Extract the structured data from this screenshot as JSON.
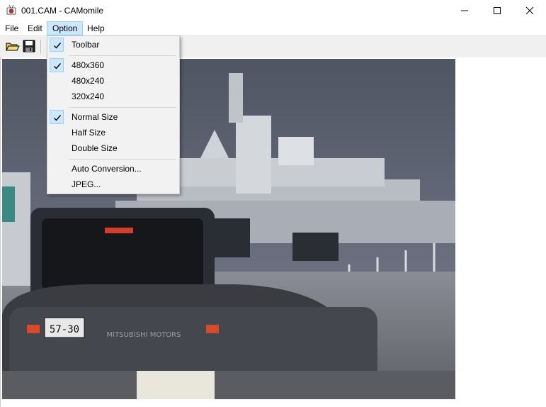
{
  "window": {
    "title": "001.CAM - CAMomile",
    "icon": "camomile-app-icon",
    "controls": [
      "minimize-icon",
      "maximize-icon",
      "close-icon"
    ]
  },
  "menubar": {
    "items": [
      {
        "label": "File"
      },
      {
        "label": "Edit"
      },
      {
        "label": "Option",
        "open": true
      },
      {
        "label": "Help"
      }
    ]
  },
  "toolbar": {
    "buttons": [
      {
        "icon": "open-folder-icon"
      },
      {
        "icon": "save-disk-icon"
      }
    ]
  },
  "option_menu": {
    "items": [
      {
        "label": "Toolbar",
        "checked": true
      },
      {
        "label": "480x360",
        "checked": true
      },
      {
        "label": "480x240",
        "checked": false
      },
      {
        "label": "320x240",
        "checked": false
      },
      {
        "label": "Normal Size",
        "checked": true
      },
      {
        "label": "Half Size",
        "checked": false
      },
      {
        "label": "Double Size",
        "checked": false
      },
      {
        "label": "Auto Conversion...",
        "checked": false
      },
      {
        "label": "JPEG...",
        "checked": false
      }
    ]
  },
  "frame": {
    "plate": "57-30",
    "vehicle_text": "MITSUBISHI MOTORS",
    "colors": {
      "sky": "#5d6372",
      "ship": "#c9ccd1",
      "road": "#7d8088",
      "car_front": "#2b2d34",
      "car_behind": "#3a3c42",
      "window_bg": "#ffffff"
    }
  }
}
